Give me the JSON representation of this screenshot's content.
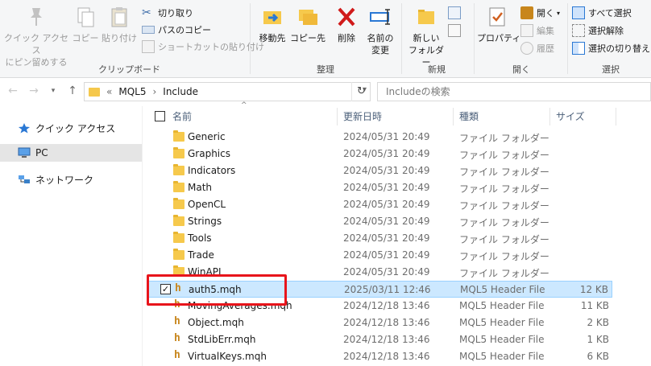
{
  "ribbon": {
    "clipboard": {
      "pin_label": "クイック アクセス\nにピン留めする",
      "copy_label": "コピー",
      "paste_label": "貼り付け",
      "cut_label": "切り取り",
      "copy_path_label": "パスのコピー",
      "paste_shortcut_label": "ショートカットの貼り付け",
      "group_label": "クリップボード"
    },
    "organize": {
      "move_label": "移動先",
      "copy_to_label": "コピー先",
      "delete_label": "削除",
      "rename_label": "名前の\n変更",
      "group_label": "整理"
    },
    "new": {
      "new_folder_label": "新しい\nフォルダー",
      "group_label": "新規"
    },
    "open": {
      "properties_label": "プロパティ",
      "open_label": "開く",
      "edit_label": "編集",
      "history_label": "履歴",
      "group_label": "開く"
    },
    "select": {
      "select_all_label": "すべて選択",
      "select_none_label": "選択解除",
      "invert_label": "選択の切り替え",
      "group_label": "選択"
    }
  },
  "address": {
    "overflow": "«",
    "crumbs": [
      "MQL5",
      "Include"
    ],
    "search_placeholder": "Includeの検索"
  },
  "navpane": {
    "items": [
      {
        "label": "クイック アクセス",
        "icon": "star-icon"
      },
      {
        "label": "PC",
        "icon": "pc-icon"
      },
      {
        "label": "ネットワーク",
        "icon": "network-icon"
      }
    ]
  },
  "columns": {
    "name": "名前",
    "date": "更新日時",
    "type": "種類",
    "size": "サイズ"
  },
  "files": [
    {
      "name": "Generic",
      "date": "2024/05/31 20:49",
      "type": "ファイル フォルダー",
      "size": "",
      "kind": "folder"
    },
    {
      "name": "Graphics",
      "date": "2024/05/31 20:49",
      "type": "ファイル フォルダー",
      "size": "",
      "kind": "folder"
    },
    {
      "name": "Indicators",
      "date": "2024/05/31 20:49",
      "type": "ファイル フォルダー",
      "size": "",
      "kind": "folder"
    },
    {
      "name": "Math",
      "date": "2024/05/31 20:49",
      "type": "ファイル フォルダー",
      "size": "",
      "kind": "folder"
    },
    {
      "name": "OpenCL",
      "date": "2024/05/31 20:49",
      "type": "ファイル フォルダー",
      "size": "",
      "kind": "folder"
    },
    {
      "name": "Strings",
      "date": "2024/05/31 20:49",
      "type": "ファイル フォルダー",
      "size": "",
      "kind": "folder"
    },
    {
      "name": "Tools",
      "date": "2024/05/31 20:49",
      "type": "ファイル フォルダー",
      "size": "",
      "kind": "folder"
    },
    {
      "name": "Trade",
      "date": "2024/05/31 20:49",
      "type": "ファイル フォルダー",
      "size": "",
      "kind": "folder"
    },
    {
      "name": "WinAPI",
      "date": "2024/05/31 20:49",
      "type": "ファイル フォルダー",
      "size": "",
      "kind": "folder"
    },
    {
      "name": "auth5.mqh",
      "date": "2025/03/11 12:46",
      "type": "MQL5 Header File",
      "size": "12 KB",
      "kind": "header",
      "selected": true
    },
    {
      "name": "MovingAverages.mqh",
      "date": "2024/12/18 13:46",
      "type": "MQL5 Header File",
      "size": "11 KB",
      "kind": "header"
    },
    {
      "name": "Object.mqh",
      "date": "2024/12/18 13:46",
      "type": "MQL5 Header File",
      "size": "2 KB",
      "kind": "header"
    },
    {
      "name": "StdLibErr.mqh",
      "date": "2024/12/18 13:46",
      "type": "MQL5 Header File",
      "size": "1 KB",
      "kind": "header"
    },
    {
      "name": "VirtualKeys.mqh",
      "date": "2024/12/18 13:46",
      "type": "MQL5 Header File",
      "size": "6 KB",
      "kind": "header"
    }
  ],
  "colors": {
    "selection_bg": "#cce8ff",
    "selection_border": "#99d1ff",
    "highlight": "#e8141b",
    "folder": "#f6c94c"
  }
}
